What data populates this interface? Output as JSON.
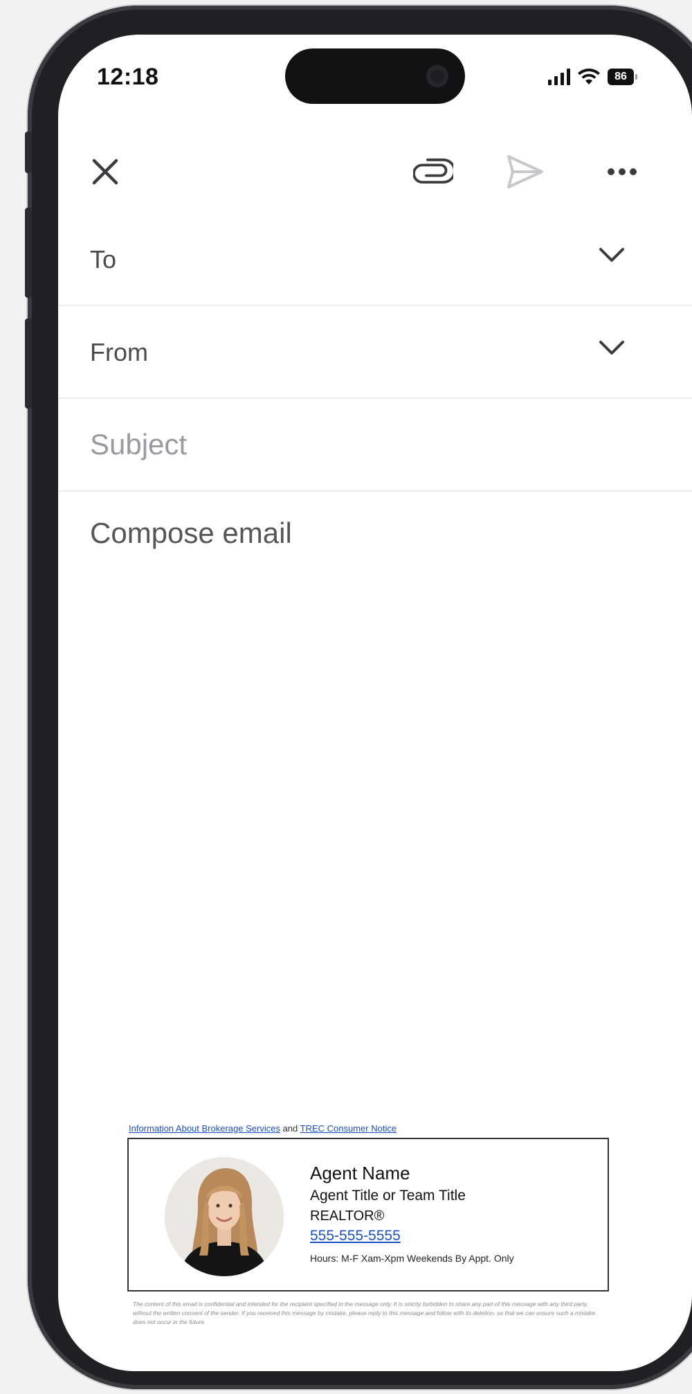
{
  "status_bar": {
    "time": "12:18",
    "battery": "86"
  },
  "toolbar": {
    "close_icon": "close-icon",
    "attach_icon": "paperclip-icon",
    "send_icon": "send-icon",
    "more_icon": "more-horizontal-icon"
  },
  "fields": {
    "to_label": "To",
    "from_label": "From",
    "subject_placeholder": "Subject",
    "compose_placeholder": "Compose email"
  },
  "signature": {
    "link1": "Information About Brokerage Services",
    "link_joiner": " and ",
    "link2": "TREC Consumer Notice",
    "name": "Agent Name",
    "title": "Agent Title or Team Title",
    "designation": "REALTOR®",
    "phone": "555-555-5555",
    "hours": "Hours: M-F Xam-Xpm Weekends By Appt. Only"
  },
  "disclaimer": "The content of this email is confidential and intended for the recipient specified in the message only. It is strictly forbidden to share any part of this message with any third party, without the written consent of the sender. If you received this message by mistake, please reply to this message and follow with its deletion, so that we can ensure such a mistake does not occur in the future.",
  "colors": {
    "link": "#1a4fc4",
    "send_disabled": "#c8c8cc",
    "frame": "#1f2024"
  }
}
